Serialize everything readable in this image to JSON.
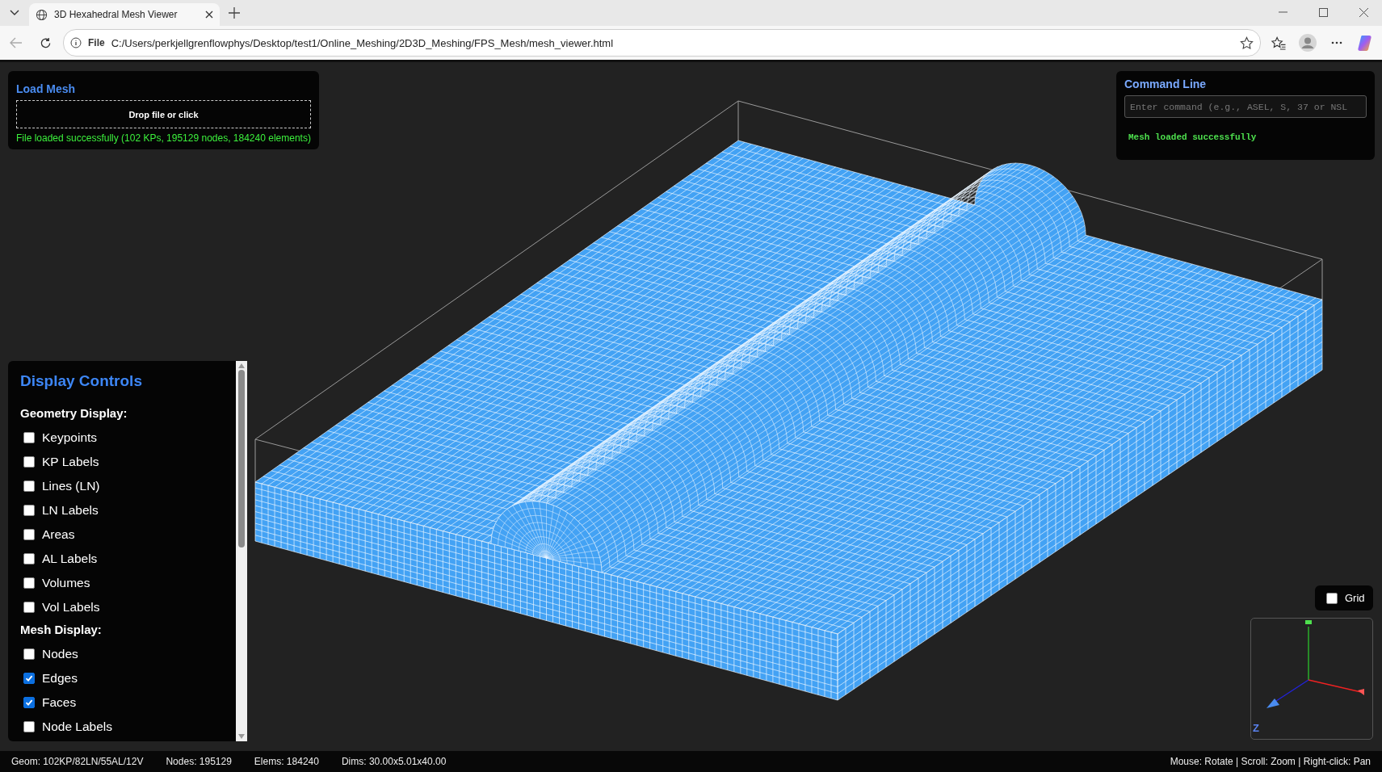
{
  "browser": {
    "tab_title": "3D Hexahedral Mesh Viewer",
    "url_scheme": "File",
    "url": "C:/Users/perkjellgrenflowphys/Desktop/test1/Online_Meshing/2D3D_Meshing/FPS_Mesh/mesh_viewer.html"
  },
  "load_mesh": {
    "title": "Load Mesh",
    "drop_zone": "Drop file or click",
    "status": "File loaded successfully (102 KPs, 195129 nodes, 184240 elements)"
  },
  "command_line": {
    "title": "Command Line",
    "placeholder": "Enter command (e.g., ASEL, S, 37 or NSL",
    "output": "Mesh loaded successfully"
  },
  "display_controls": {
    "title": "Display Controls",
    "sections": [
      {
        "heading": "Geometry Display:",
        "items": [
          {
            "label": "Keypoints",
            "checked": false
          },
          {
            "label": "KP Labels",
            "checked": false
          },
          {
            "label": "Lines (LN)",
            "checked": false
          },
          {
            "label": "LN Labels",
            "checked": false
          },
          {
            "label": "Areas",
            "checked": false
          },
          {
            "label": "AL Labels",
            "checked": false
          },
          {
            "label": "Volumes",
            "checked": false
          },
          {
            "label": "Vol Labels",
            "checked": false
          }
        ]
      },
      {
        "heading": "Mesh Display:",
        "items": [
          {
            "label": "Nodes",
            "checked": false
          },
          {
            "label": "Edges",
            "checked": true
          },
          {
            "label": "Faces",
            "checked": true
          },
          {
            "label": "Node Labels",
            "checked": false
          }
        ]
      }
    ]
  },
  "grid_toggle": {
    "label": "Grid",
    "checked": false
  },
  "axis_gizmo": {
    "label": "Z"
  },
  "status_bar": {
    "items": [
      "Geom: 102KP/82LN/55AL/12V",
      "Nodes: 195129",
      "Elems: 184240",
      "Dims: 30.00x5.01x40.00"
    ],
    "hint": "Mouse: Rotate | Scroll: Zoom | Right-click: Pan"
  }
}
